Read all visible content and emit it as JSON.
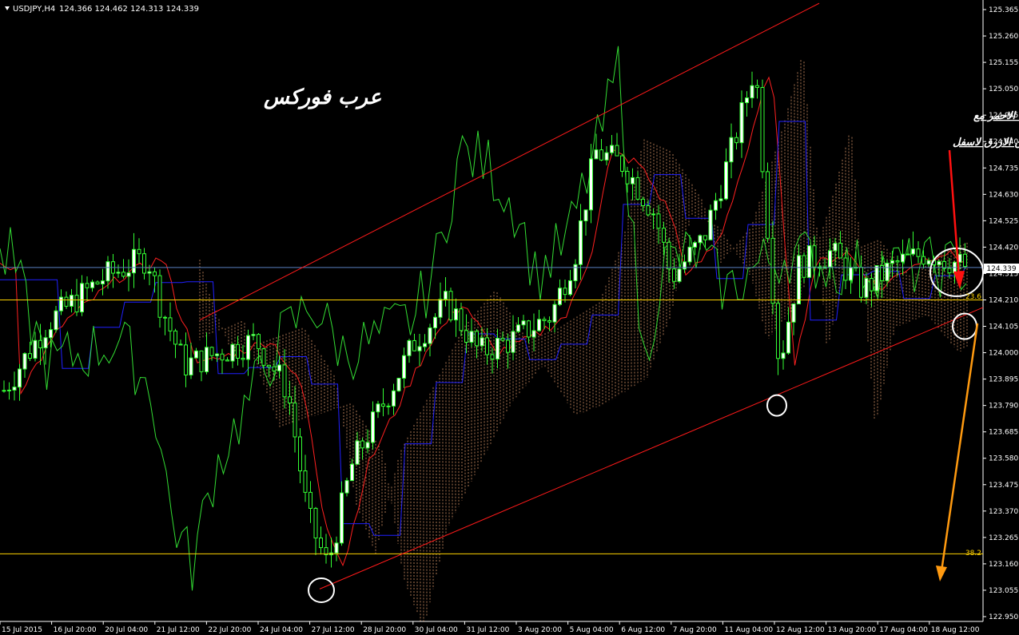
{
  "header": {
    "symbol": "USDJPY,H4",
    "ohlc": "124.366 124.462 124.313 124.339"
  },
  "brand_text": "عرب فوركس",
  "annotation": {
    "line1": "تقاطع خطي التنكان الاحمر مع",
    "line2": "الكيجين الازرق لاسفل"
  },
  "colors": {
    "background": "#000000",
    "bull_candle": "#33ff33",
    "bear_candle": "#33ff33",
    "candle_body_fill": "#ffffff",
    "tenkan": "#ff2020",
    "kijun": "#2020ff",
    "chikou": "#33dd33",
    "cloud": "#ffb07a",
    "channel": "#ff1a1a",
    "fib": "#ffd200",
    "bid_line": "#5a7fc0",
    "arrow_red": "#ff1010",
    "arrow_orange": "#ff9a10",
    "circle": "#ffffff"
  },
  "chart_data": {
    "type": "candlestick",
    "y_ticks": [
      "125.365",
      "125.260",
      "125.155",
      "125.050",
      "124.945",
      "124.840",
      "124.735",
      "124.630",
      "124.525",
      "124.420",
      "124.315",
      "124.210",
      "124.105",
      "124.000",
      "123.895",
      "123.790",
      "123.685",
      "123.580",
      "123.475",
      "123.370",
      "123.265",
      "123.160",
      "123.055",
      "122.950"
    ],
    "ylim": [
      122.92,
      125.38
    ],
    "x_ticks": [
      "15 Jul 2015",
      "16 Jul 20:00",
      "20 Jul 04:00",
      "21 Jul 12:00",
      "22 Jul 20:00",
      "24 Jul 04:00",
      "27 Jul 12:00",
      "28 Jul 20:00",
      "30 Jul 04:00",
      "31 Jul 12:00",
      "3 Aug 20:00",
      "5 Aug 04:00",
      "6 Aug 12:00",
      "7 Aug 20:00",
      "11 Aug 04:00",
      "12 Aug 12:00",
      "13 Aug 20:00",
      "17 Aug 04:00",
      "18 Aug 12:00"
    ],
    "current_price": "124.339",
    "fib_levels": [
      {
        "label": "23.6",
        "price": 124.21
      },
      {
        "label": "38.2",
        "price": 123.2
      }
    ],
    "key_prices": [
      124.105,
      124.0,
      123.79,
      123.055,
      125.26,
      124.2
    ]
  }
}
